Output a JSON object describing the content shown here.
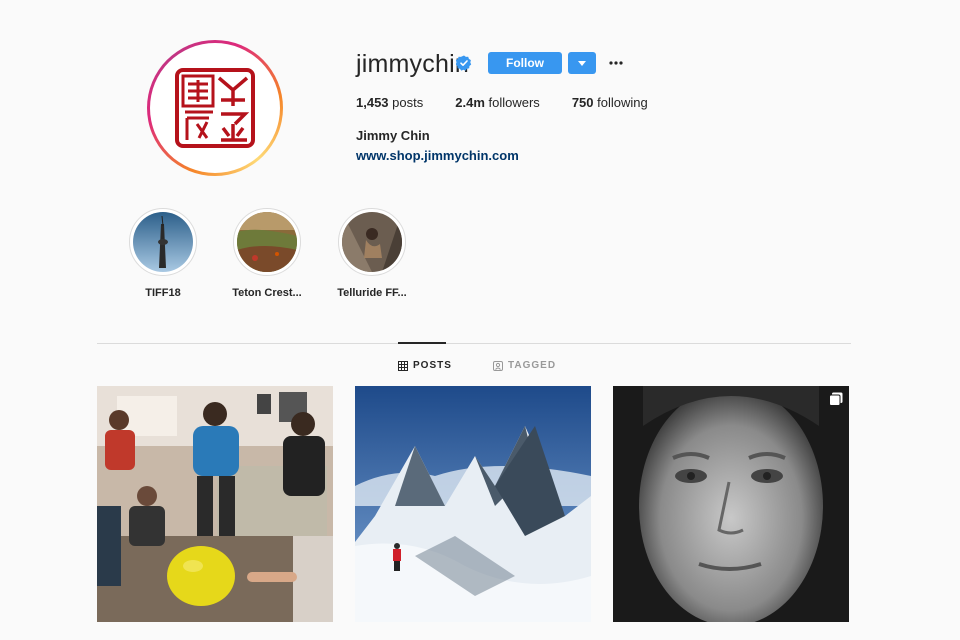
{
  "profile": {
    "username": "jimmychin",
    "verified": true,
    "follow_label": "Follow",
    "stats": {
      "posts_count": "1,453",
      "posts_label": "posts",
      "followers_count": "2.4m",
      "followers_label": "followers",
      "following_count": "750",
      "following_label": "following"
    },
    "full_name": "Jimmy Chin",
    "website": "www.shop.jimmychin.com"
  },
  "highlights": [
    {
      "label": "TIFF18"
    },
    {
      "label": "Teton Crest..."
    },
    {
      "label": "Telluride FF..."
    }
  ],
  "tabs": [
    {
      "label": "POSTS",
      "active": true,
      "icon": "grid-icon"
    },
    {
      "label": "TAGGED",
      "active": false,
      "icon": "tagged-icon"
    }
  ],
  "posts": [
    {
      "description_icon": "photo",
      "multi": false
    },
    {
      "description_icon": "photo",
      "multi": false
    },
    {
      "description_icon": "photo",
      "multi": true
    }
  ],
  "colors": {
    "accent": "#3897f0",
    "link": "#003569",
    "seal_red": "#b5121b"
  }
}
